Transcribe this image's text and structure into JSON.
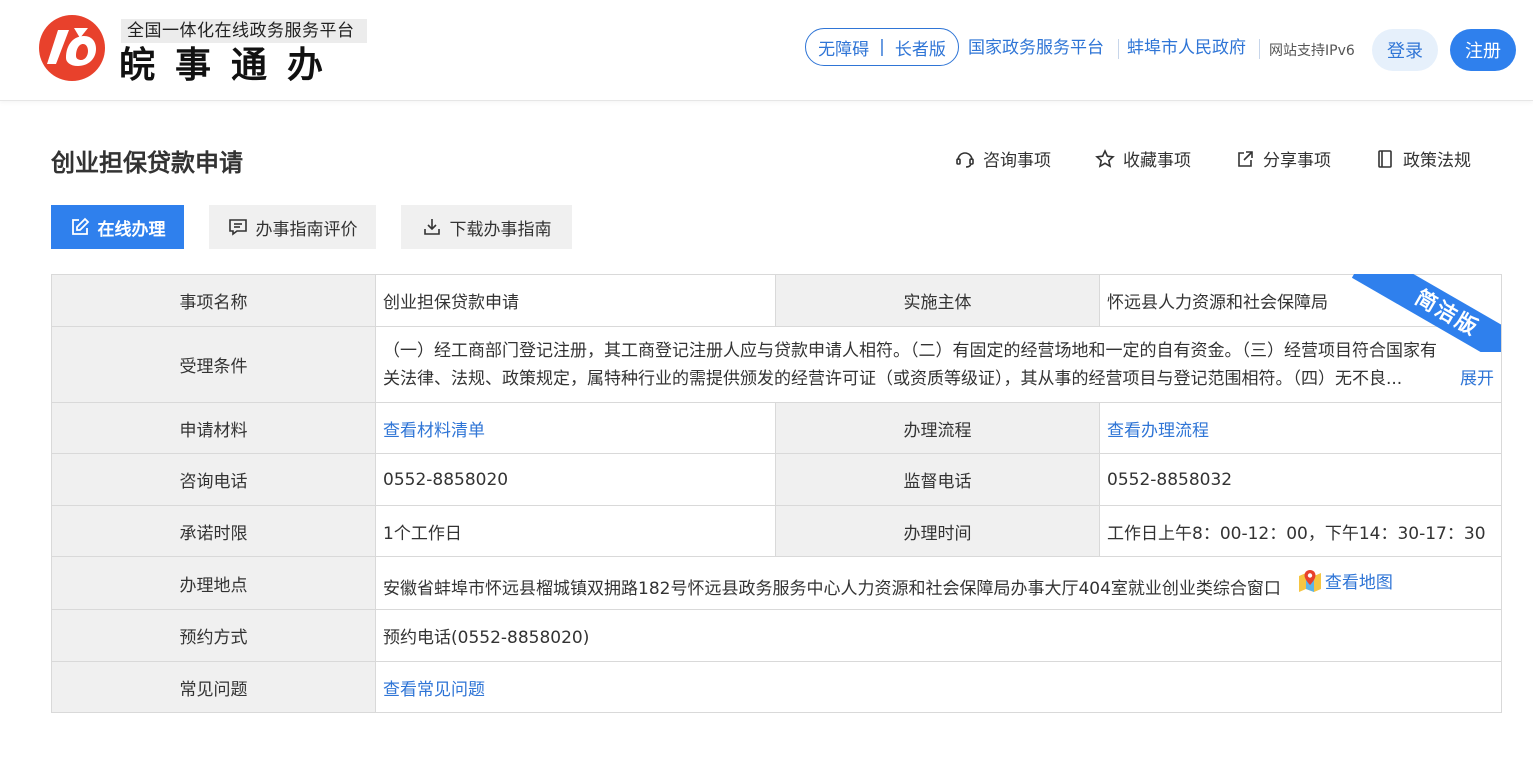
{
  "header": {
    "logo_subtitle": "全国一体化在线政务服务平台",
    "logo_title": "皖事通办",
    "access_pill": {
      "barrier_free": "无障碍",
      "separator": "|",
      "elder": "长者版"
    },
    "links": [
      "国家政务服务平台",
      "蚌埠市人民政府"
    ],
    "ipv6": "网站支持IPv6",
    "login": "登录",
    "register": "注册"
  },
  "page": {
    "title": "创业担保贷款申请",
    "actions": [
      {
        "label": "咨询事项",
        "icon": "consult-icon"
      },
      {
        "label": "收藏事项",
        "icon": "star-icon"
      },
      {
        "label": "分享事项",
        "icon": "share-icon"
      },
      {
        "label": "政策法规",
        "icon": "book-icon"
      }
    ],
    "buttons": {
      "online": "在线办理",
      "evaluate": "办事指南评价",
      "download": "下载办事指南"
    }
  },
  "table": {
    "ribbon": "简洁版",
    "item_name_label": "事项名称",
    "item_name": "创业担保贷款申请",
    "subject_label": "实施主体",
    "subject": "怀远县人力资源和社会保障局",
    "condition_label": "受理条件",
    "condition": "（一）经工商部门登记注册，其工商登记注册人应与贷款申请人相符。（二）有固定的经营场地和一定的自有资金。（三）经营项目符合国家有关法律、法规、政策规定，属特种行业的需提供颁发的经营许可证（或资质等级证），其从事的经营项目与登记范围相符。（四）无不良...",
    "expand": "展开",
    "materials_label": "申请材料",
    "materials_link": "查看材料清单",
    "process_label": "办理流程",
    "process_link": "查看办理流程",
    "consult_phone_label": "咨询电话",
    "consult_phone": "0552-8858020",
    "supervise_phone_label": "监督电话",
    "supervise_phone": "0552-8858032",
    "time_limit_label": "承诺时限",
    "time_limit": "1个工作日",
    "hours_label": "办理时间",
    "hours": "工作日上午8：00-12：00，下午14：30-17：30",
    "location_label": "办理地点",
    "location": "安徽省蚌埠市怀远县榴城镇双拥路182号怀远县政务服务中心人力资源和社会保障局办事大厅404室就业创业类综合窗口",
    "map_link": "查看地图",
    "appointment_label": "预约方式",
    "appointment": "预约电话(0552-8858020)",
    "faq_label": "常见问题",
    "faq_link": "查看常见问题"
  },
  "colors": {
    "brand_red": "#e8412c",
    "primary_blue": "#2f80ed",
    "link_blue": "#2f75d6"
  }
}
